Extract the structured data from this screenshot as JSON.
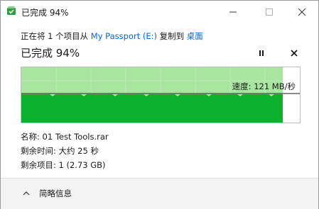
{
  "window": {
    "title": "已完成 94%"
  },
  "copy": {
    "prefix": "正在将 1 个项目从 ",
    "source": "My Passport (E:)",
    "middle": " 复制到 ",
    "destination": "桌面"
  },
  "status": {
    "text": "已完成 94%"
  },
  "graph": {
    "progress": 0.94,
    "speed_label": "速度: 121 MB/秒",
    "colors": {
      "completed_light": "#a8e6a0",
      "throughput_fill": "#0cb12f",
      "remaining": "#ffffff"
    }
  },
  "details": {
    "name": "名称: 01 Test Tools.rar",
    "time_remaining": "剩余时间: 大约 25 秒",
    "items_remaining": "剩余项目: 1 (2.73 GB)"
  },
  "footer": {
    "toggle_label": "简略信息"
  }
}
